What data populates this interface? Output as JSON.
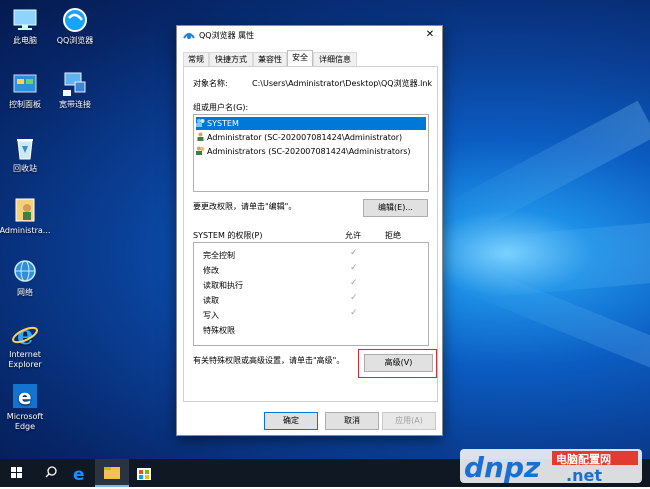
{
  "desktop_icons": [
    {
      "label": "此电脑",
      "icon": "pc-icon"
    },
    {
      "label": "QQ浏览器",
      "icon": "qq-browser-icon"
    },
    {
      "label": "控制面板",
      "icon": "control-panel-icon"
    },
    {
      "label": "宽带连接",
      "icon": "network-connection-icon"
    },
    {
      "label": "回收站",
      "icon": "recycle-bin-icon"
    },
    {
      "label": "Administra...",
      "icon": "user-folder-icon"
    },
    {
      "label": "网络",
      "icon": "network-icon"
    },
    {
      "label": "Internet Explorer",
      "icon": "ie-icon"
    },
    {
      "label": "Microsoft Edge",
      "icon": "edge-icon"
    }
  ],
  "dialog": {
    "title": "QQ浏览器 属性",
    "close_glyph": "✕",
    "tabs": [
      "常规",
      "快捷方式",
      "兼容性",
      "安全",
      "详细信息"
    ],
    "active_tab": "安全",
    "object_name_label": "对象名称:",
    "object_name_value": "C:\\Users\\Administrator\\Desktop\\QQ浏览器.lnk",
    "group_label": "组或用户名(G):",
    "users": [
      "SYSTEM",
      "Administrator (SC-202007081424\\Administrator)",
      "Administrators (SC-202007081424\\Administrators)"
    ],
    "change_perm_text": "要更改权限，请单击\"编辑\"。",
    "edit_button": "编辑(E)...",
    "perm_header": "SYSTEM 的权限(P)",
    "allow_header": "允许",
    "deny_header": "拒绝",
    "permissions": [
      {
        "name": "完全控制",
        "allow": true
      },
      {
        "name": "修改",
        "allow": true
      },
      {
        "name": "读取和执行",
        "allow": true
      },
      {
        "name": "读取",
        "allow": true
      },
      {
        "name": "写入",
        "allow": true
      },
      {
        "name": "特殊权限",
        "allow": false
      }
    ],
    "check_glyph": "✓",
    "special_text": "有关特殊权限或高级设置，请单击\"高级\"。",
    "advanced_button": "高级(V)",
    "ok_button": "确定",
    "cancel_button": "取消",
    "apply_button": "应用(A)"
  },
  "taskbar": {
    "search_glyph": "⚲"
  },
  "watermark": {
    "text_left": "dnpz",
    "text_top": "电脑配置网",
    "text_bottom": ".net"
  },
  "colors": {
    "accent": "#0078d7",
    "highlight": "#e0282e",
    "taskbar": "#101923"
  }
}
